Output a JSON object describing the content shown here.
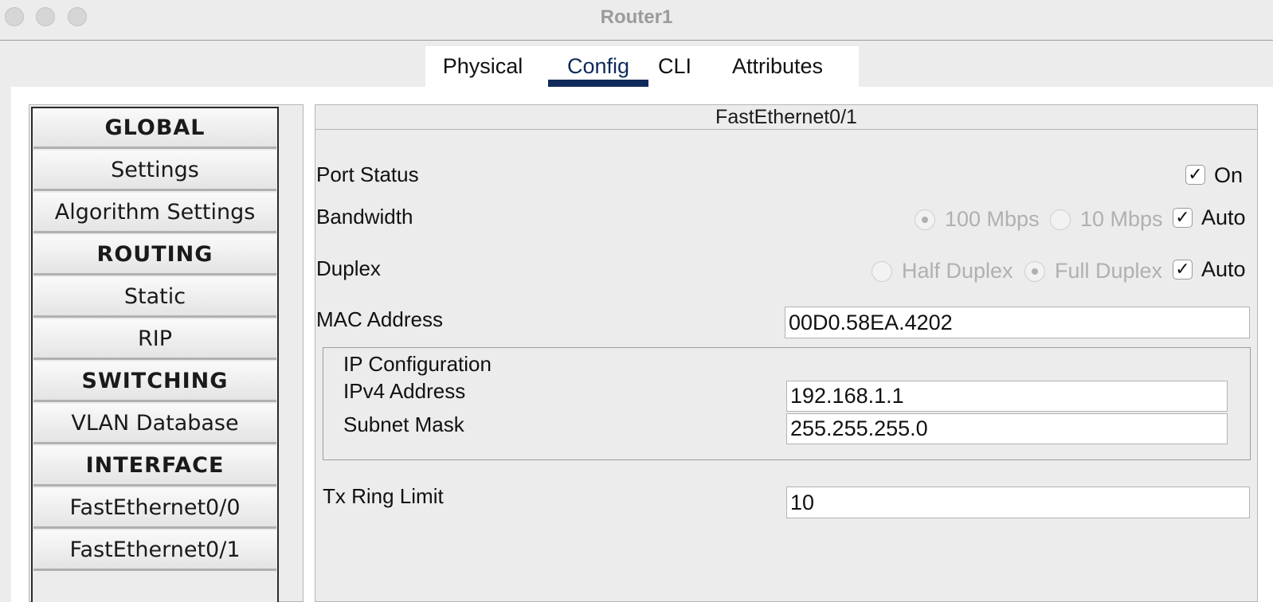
{
  "window": {
    "title": "Router1"
  },
  "tabs": [
    {
      "label": "Physical",
      "active": false
    },
    {
      "label": "Config",
      "active": true
    },
    {
      "label": "CLI",
      "active": false
    },
    {
      "label": "Attributes",
      "active": false
    }
  ],
  "sidebar": {
    "items": [
      {
        "label": "GLOBAL",
        "header": true
      },
      {
        "label": "Settings",
        "header": false
      },
      {
        "label": "Algorithm Settings",
        "header": false
      },
      {
        "label": "ROUTING",
        "header": true
      },
      {
        "label": "Static",
        "header": false
      },
      {
        "label": "RIP",
        "header": false
      },
      {
        "label": "SWITCHING",
        "header": true
      },
      {
        "label": "VLAN Database",
        "header": false
      },
      {
        "label": "INTERFACE",
        "header": true
      },
      {
        "label": "FastEthernet0/0",
        "header": false
      },
      {
        "label": "FastEthernet0/1",
        "header": false
      }
    ]
  },
  "interface": {
    "title": "FastEthernet0/1",
    "port_status": {
      "label": "Port Status",
      "on_label": "On",
      "checked": true
    },
    "bandwidth": {
      "label": "Bandwidth",
      "opt1": "100 Mbps",
      "opt2": "10 Mbps",
      "auto_label": "Auto",
      "auto_checked": true,
      "selected": "100 Mbps"
    },
    "duplex": {
      "label": "Duplex",
      "opt1": "Half Duplex",
      "opt2": "Full Duplex",
      "auto_label": "Auto",
      "auto_checked": true,
      "selected": "Full Duplex"
    },
    "mac": {
      "label": "MAC Address",
      "value": "00D0.58EA.4202"
    },
    "ip_config": {
      "title": "IP Configuration",
      "ipv4_label": "IPv4 Address",
      "ipv4_value": "192.168.1.1",
      "subnet_label": "Subnet Mask",
      "subnet_value": "255.255.255.0"
    },
    "tx_ring": {
      "label": "Tx Ring Limit",
      "value": "10"
    }
  },
  "checkmark": "✓"
}
